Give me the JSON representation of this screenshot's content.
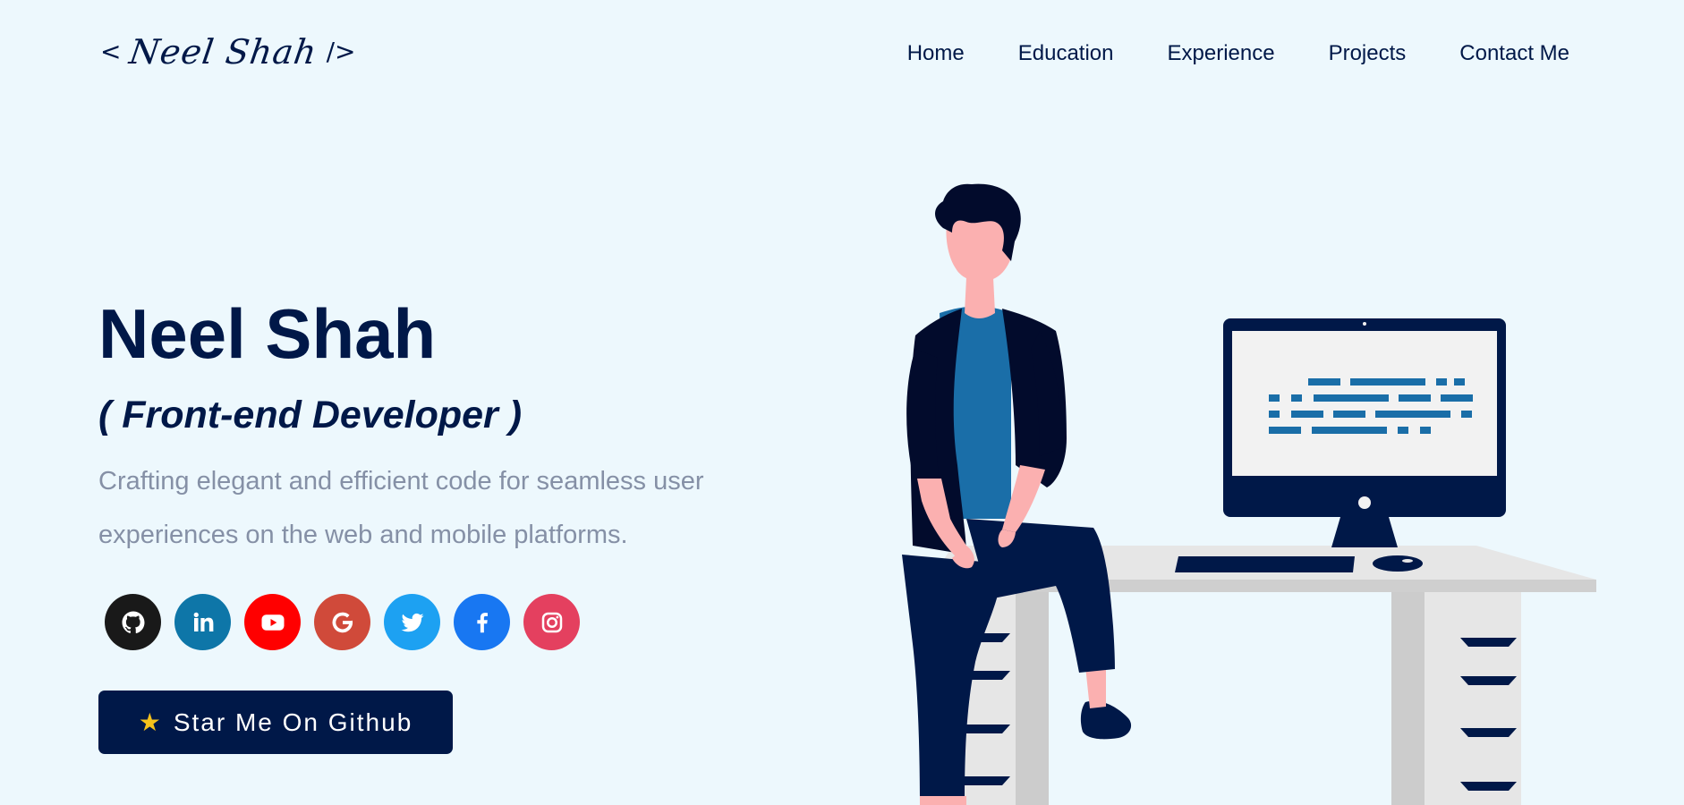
{
  "header": {
    "logo": {
      "open": "<",
      "name": "Neel Shah",
      "close": "/>"
    },
    "nav": [
      "Home",
      "Education",
      "Experience",
      "Projects",
      "Contact Me"
    ]
  },
  "hero": {
    "name": "Neel Shah",
    "role": "( Front-end Developer )",
    "description": "Crafting elegant and efficient code for seamless user experiences on the web and mobile platforms."
  },
  "socials": [
    {
      "name": "github-icon",
      "color": "#191919"
    },
    {
      "name": "linkedin-icon",
      "color": "#0e76a8"
    },
    {
      "name": "youtube-icon",
      "color": "#ff0000"
    },
    {
      "name": "google-icon",
      "color": "#d04a3a"
    },
    {
      "name": "twitter-icon",
      "color": "#1da1f2"
    },
    {
      "name": "facebook-icon",
      "color": "#1877f2"
    },
    {
      "name": "instagram-icon",
      "color": "#e4405f"
    }
  ],
  "cta": {
    "icon": "star-icon",
    "label": "Star Me On Github"
  },
  "colors": {
    "background": "#edf8fd",
    "primary": "#001848",
    "muted_text": "#8590a6",
    "accent_blue": "#1a6ea8",
    "star": "#f6c21b"
  }
}
